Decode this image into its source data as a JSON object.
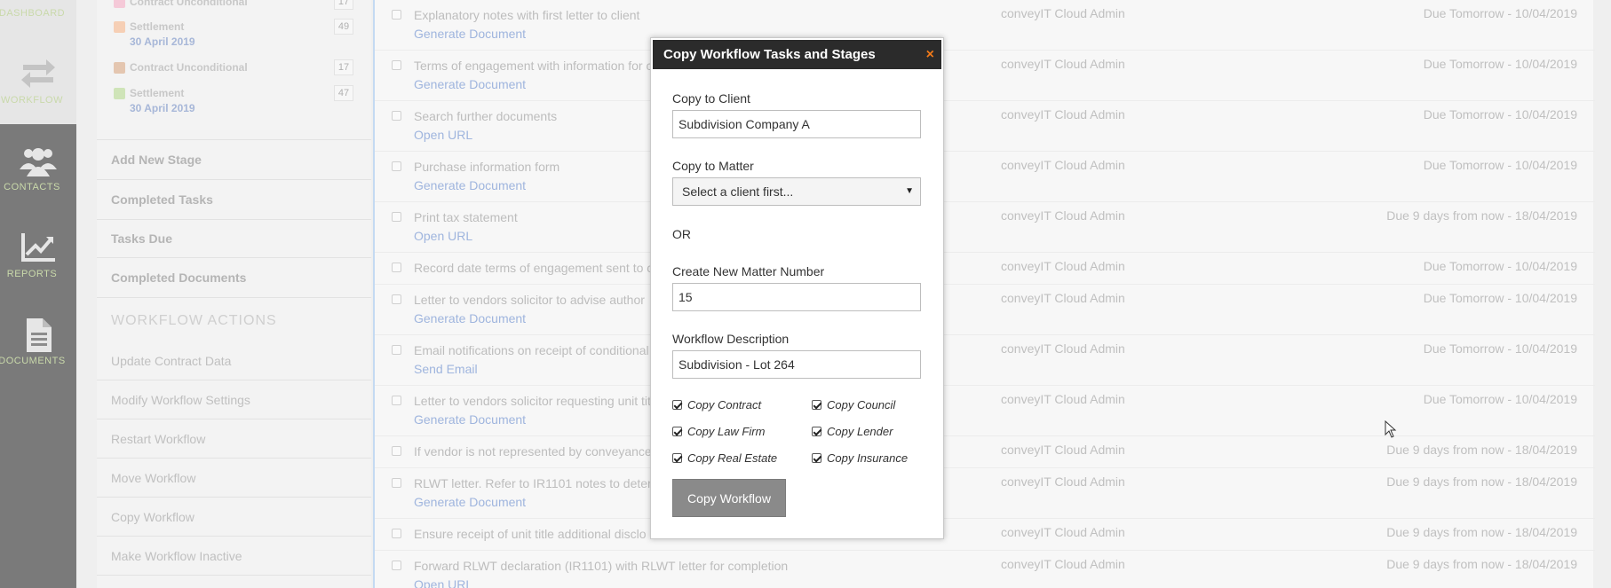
{
  "rail": [
    {
      "label": "DASHBOARD",
      "icon": "dashboard-icon"
    },
    {
      "label": "WORKFLOW",
      "icon": "workflow-arrows-icon"
    },
    {
      "label": "CONTACTS",
      "icon": "contacts-group-icon"
    },
    {
      "label": "REPORTS",
      "icon": "reports-chart-icon"
    },
    {
      "label": "DOCUMENTS",
      "icon": "document-icon"
    }
  ],
  "stages": [
    {
      "name": "Contract Unconditional",
      "count": "17",
      "color": "#f5c9d8"
    },
    {
      "name": "Settlement",
      "date": "30 April 2019",
      "count": "49",
      "color": "#f6cfb5"
    },
    {
      "name": "Contract Unconditional",
      "count": "17",
      "color": "#e4c6b0"
    },
    {
      "name": "Settlement",
      "date": "30 April 2019",
      "count": "47",
      "color": "#cfe4b8"
    }
  ],
  "sidebar": {
    "links": [
      "Add New Stage",
      "Completed Tasks",
      "Tasks Due",
      "Completed Documents"
    ],
    "actions_heading": "WORKFLOW ACTIONS",
    "actions": [
      "Update Contract Data",
      "Modify Workflow Settings",
      "Restart Workflow",
      "Move Workflow",
      "Copy Workflow",
      "Make Workflow Inactive"
    ]
  },
  "tasks": [
    {
      "title": "Explanatory notes with first letter to client",
      "link": "Generate Document",
      "assignee": "conveyIT Cloud Admin",
      "due": "Due Tomorrow - 10/04/2019"
    },
    {
      "title": "Terms of engagement with information for c",
      "link": "Generate Document",
      "assignee": "conveyIT Cloud Admin",
      "due": "Due Tomorrow - 10/04/2019"
    },
    {
      "title": "Search further documents",
      "link": "Open URL",
      "assignee": "conveyIT Cloud Admin",
      "due": "Due Tomorrow - 10/04/2019"
    },
    {
      "title": "Purchase information form",
      "link": "Generate Document",
      "assignee": "conveyIT Cloud Admin",
      "due": "Due Tomorrow - 10/04/2019"
    },
    {
      "title": "Print tax statement",
      "link": "Open URL",
      "assignee": "conveyIT Cloud Admin",
      "due": "Due 9 days from now - 18/04/2019"
    },
    {
      "title": "Record date terms of engagement sent to c",
      "link": "",
      "assignee": "conveyIT Cloud Admin",
      "due": "Due Tomorrow - 10/04/2019"
    },
    {
      "title": "Letter to vendors solicitor to advise author",
      "link": "Generate Document",
      "assignee": "conveyIT Cloud Admin",
      "due": "Due Tomorrow - 10/04/2019"
    },
    {
      "title": "Email notifications on receipt of conditional",
      "link": "Send Email",
      "assignee": "conveyIT Cloud Admin",
      "due": "Due Tomorrow - 10/04/2019"
    },
    {
      "title": "Letter to vendors solicitor requesting unit tit",
      "link": "Generate Document",
      "assignee": "conveyIT Cloud Admin",
      "due": "Due Tomorrow - 10/04/2019"
    },
    {
      "title": "If vendor is not represented by conveyance",
      "link": "",
      "assignee": "conveyIT Cloud Admin",
      "due": "Due 9 days from now - 18/04/2019"
    },
    {
      "title": "RLWT letter. Refer to IR1101 notes to deter",
      "link": "Generate Document",
      "assignee": "conveyIT Cloud Admin",
      "due": "Due 9 days from now - 18/04/2019"
    },
    {
      "title": "Ensure receipt of unit title additional disclo",
      "link": "",
      "assignee": "conveyIT Cloud Admin",
      "due": "Due 9 days from now - 18/04/2019"
    },
    {
      "title": "Forward RLWT declaration (IR1101) with RLWT letter for completion",
      "link": "Open URL",
      "assignee": "conveyIT Cloud Admin",
      "due": "Due 9 days from now - 18/04/2019"
    }
  ],
  "dialog": {
    "title": "Copy Workflow Tasks and Stages",
    "close": "×",
    "copy_to_client_label": "Copy to Client",
    "copy_to_client_value": "Subdivision Company A",
    "copy_to_matter_label": "Copy to Matter",
    "copy_to_matter_value": "Select a client first...",
    "or": "OR",
    "new_matter_label": "Create New Matter Number",
    "new_matter_value": "15",
    "description_label": "Workflow Description",
    "description_value": "Subdivision - Lot 264",
    "checkboxes": [
      "Copy Contract",
      "Copy Council",
      "Copy Law Firm",
      "Copy Lender",
      "Copy Real Estate",
      "Copy Insurance"
    ],
    "button": "Copy Workflow"
  }
}
